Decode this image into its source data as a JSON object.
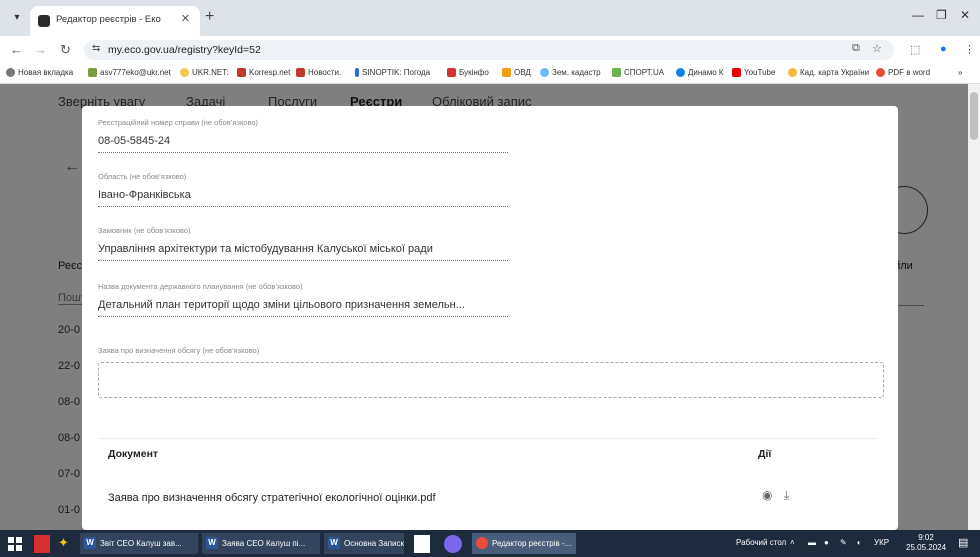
{
  "browser": {
    "tab_title": "Редактор реєстрів - Еко",
    "url": "my.eco.gov.ua/registry?keyId=52",
    "bookmarks": [
      "Новая вкладка",
      "asv777eko@ukr.net",
      "UKR.NET:",
      "Korresp.net",
      "Новости.",
      "SINOPTIK: Погода",
      "Букінфо",
      "ОВД",
      "Зем. кадастр",
      "СПОРТ.UA",
      "Динамо К",
      "YouTube",
      "Кад. карта України",
      "PDF в word"
    ],
    "overflow": "»"
  },
  "page": {
    "nav_tabs": [
      "Зверніть увагу",
      "Задачі",
      "Послуги",
      "Реєстри",
      "Обліковий запис"
    ],
    "registry_header": "Реєс",
    "files_header": "айли",
    "search_placeholder": "Пошу",
    "rows": [
      "20-0",
      "22-0",
      "08-0",
      "08-0",
      "07-0",
      "01-0"
    ]
  },
  "modal": {
    "case_number": {
      "label": "Реєстраційний номер справи (не обов’язково)",
      "value": "08-05-5845-24"
    },
    "region": {
      "label": "Область (не обов’язково)",
      "value": "Івано-Франківська"
    },
    "customer": {
      "label": "Замовник (не обов’язково)",
      "value": "Управління архітектури та містобудування Калуської міської ради"
    },
    "document_name": {
      "label": "Назва документа державного планування (не обов’язково)",
      "value": "Детальний план території щодо зміни цільового призначення земельн..."
    },
    "statement": {
      "label": "Заява про визначення обсягу (не обов’язково)"
    },
    "table": {
      "col_document": "Документ",
      "col_actions": "Дії",
      "rows": [
        {
          "name": "Заява про визначення обсягу стратегічної екологічної оцінки.pdf"
        }
      ]
    }
  },
  "taskbar": {
    "items": [
      "Звіт СЕО Калуш зав...",
      "Заява СЕО Калуш пі...",
      "Основна Записка -...",
      "Редактор реєстрів -..."
    ],
    "desktop_label": "Рабочий стол",
    "lang": "УКР",
    "time": "9:02",
    "date": "25.05.2024"
  }
}
